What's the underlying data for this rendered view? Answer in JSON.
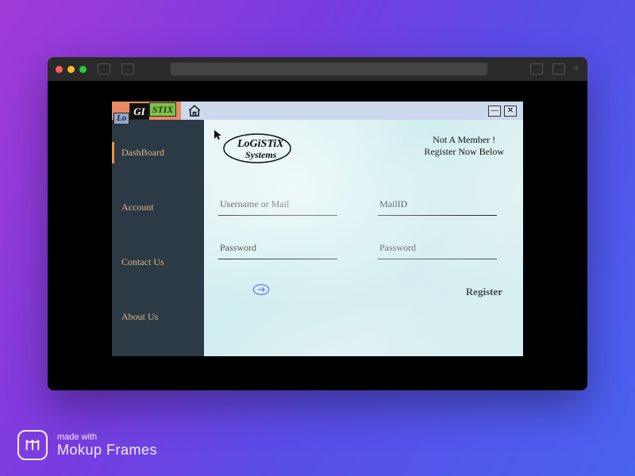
{
  "watermark": {
    "small": "made with",
    "big": "Mokup Frames"
  },
  "app": {
    "logo": {
      "chip1": "Lo",
      "chip2": "GI",
      "chip3": "STIX"
    },
    "brand": {
      "line1": "LoGiSTiX",
      "line2": "Systems"
    },
    "sidebar": {
      "items": [
        {
          "label": "DashBoard",
          "active": true
        },
        {
          "label": "Account",
          "active": false
        },
        {
          "label": "Contact Us",
          "active": false
        },
        {
          "label": "About Us",
          "active": false
        }
      ]
    },
    "member_msg": {
      "line1": "Not A Member !",
      "line2": "Register Now Below"
    },
    "login": {
      "user_placeholder": "Username or Mail",
      "pass_placeholder": "Password"
    },
    "register": {
      "mail_placeholder": "MailID",
      "pass_placeholder": "Password",
      "button": "Register"
    }
  }
}
